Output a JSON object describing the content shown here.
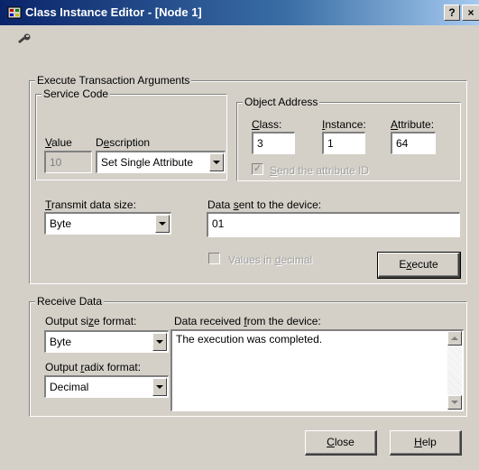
{
  "window": {
    "title": "Class Instance Editor - [Node 1]",
    "help_button": "?",
    "close_button": "×",
    "toolbar_icon": "wrench-icon"
  },
  "execute": {
    "group_label": "Execute Transaction Arguments",
    "service_code": {
      "group_label": "Service Code",
      "value_label": "Value",
      "description_label": "Description",
      "value": "10",
      "description": "Set Single Attribute"
    },
    "object_address": {
      "group_label": "Object Address",
      "class_label": "Class:",
      "instance_label": "Instance:",
      "attribute_label": "Attribute:",
      "class_value": "3",
      "instance_value": "1",
      "attribute_value": "64",
      "send_attribute_label": "Send the attribute ID",
      "send_attribute_checked": true
    },
    "transmit_size_label": "Transmit data size:",
    "transmit_size_value": "Byte",
    "data_sent_label": "Data sent to the device:",
    "data_sent_value": "01",
    "decimal_label": "Values in decimal",
    "execute_button": "Execute"
  },
  "receive": {
    "group_label": "Receive Data",
    "output_size_label": "Output size format:",
    "output_size_value": "Byte",
    "output_radix_label": "Output radix format:",
    "output_radix_value": "Decimal",
    "data_received_label": "Data received from the device:",
    "data_received_value": "The execution was completed."
  },
  "buttons": {
    "close": "Close",
    "help": "Help"
  }
}
